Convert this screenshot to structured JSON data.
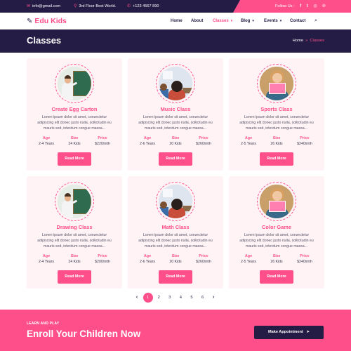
{
  "topbar": {
    "email": "info@gmail.com",
    "address": "3rd Floor Best World.",
    "phone": "+123 4567 890",
    "follow_label": "Follow Us :",
    "social": [
      {
        "icon": "facebook-icon",
        "glyph": "f"
      },
      {
        "icon": "twitter-icon",
        "glyph": "t"
      },
      {
        "icon": "instagram-icon",
        "glyph": "◎"
      },
      {
        "icon": "pinterest-icon",
        "glyph": "℗"
      }
    ]
  },
  "brand": {
    "name": "Edu Kids",
    "icon": "pencil-icon"
  },
  "nav": {
    "items": [
      {
        "label": "Home"
      },
      {
        "label": "About"
      },
      {
        "label": "Classes"
      },
      {
        "label": "Blog"
      },
      {
        "label": "Events"
      },
      {
        "label": "Contact"
      }
    ],
    "search_icon": "search-icon"
  },
  "page": {
    "title": "Classes",
    "breadcrumb": {
      "home": "Home",
      "current": "Classes",
      "separator": "»"
    }
  },
  "stat_labels": {
    "age": "Age",
    "size": "Size",
    "price": "Price"
  },
  "button_label": "Read More",
  "classes": [
    {
      "title": "Create Egg Carton",
      "desc": "Lorem ipsum dolor sit amet, consectetur adipiscing elit donec justo nulla, sollicitudin eu mauris sed, interdum congue massa...",
      "age": "2-4 Years",
      "size": "24 Kids",
      "price": "$220/mth",
      "photo": "teacher-at-board"
    },
    {
      "title": "Music Class",
      "desc": "Lorem ipsum dolor sit amet, consectetur adipiscing elit donec justo nulla, sollicitudin eu mauris sed, interdum congue massa...",
      "age": "2-6 Years",
      "size": "20 Kids",
      "price": "$260/mth",
      "photo": "kids-in-classroom"
    },
    {
      "title": "Sports Class",
      "desc": "Lorem ipsum dolor sit amet, consectetur adipiscing elit donec justo nulla, sollicitudin eu mauris sed, interdum congue massa...",
      "age": "2-5 Years",
      "size": "26 Kids",
      "price": "$240/mth",
      "photo": "girl-with-sign"
    },
    {
      "title": "Drawing Class",
      "desc": "Lorem ipsum dolor sit amet, consectetur adipiscing elit donec justo nulla, sollicitudin eu mauris sed, interdum congue massa...",
      "age": "2-4 Years",
      "size": "24 Kids",
      "price": "$200/mth",
      "photo": "teacher-at-board"
    },
    {
      "title": "Math Class",
      "desc": "Lorem ipsum dolor sit amet, consectetur adipiscing elit donec justo nulla, sollicitudin eu mauris sed, interdum congue massa...",
      "age": "2-6 Years",
      "size": "20 Kids",
      "price": "$260/mth",
      "photo": "kids-in-classroom"
    },
    {
      "title": "Color Game",
      "desc": "Lorem ipsum dolor sit amet, consectetur adipiscing elit donec justo nulla, sollicitudin eu mauris sed, interdum congue massa...",
      "age": "2-5 Years",
      "size": "26 Kids",
      "price": "$240/mth",
      "photo": "girl-with-sign"
    }
  ],
  "pagination": {
    "prev": "‹",
    "pages": [
      "1",
      "2",
      "3",
      "4",
      "5",
      "6"
    ],
    "current": "1",
    "next": "›"
  },
  "cta": {
    "kicker": "LEARN AND PLAY",
    "title": "Enroll Your Children Now",
    "button": "Make Appointment",
    "button_icon": "send-icon"
  },
  "colors": {
    "primary": "#ff4f8b",
    "dark": "#241c45",
    "card_bg": "#fff3f6"
  }
}
